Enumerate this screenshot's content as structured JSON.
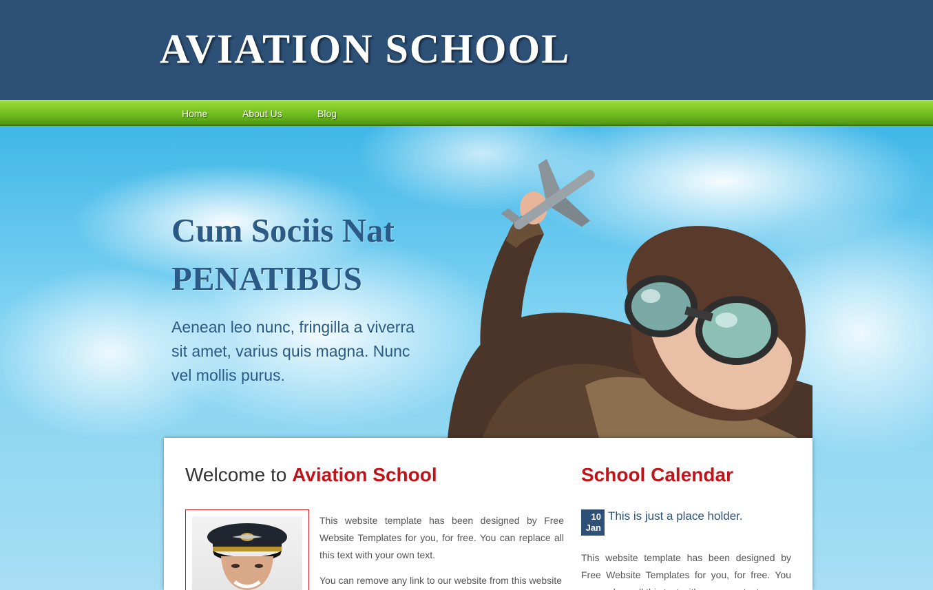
{
  "header": {
    "logo_text": "AVIATION SCHOOL"
  },
  "nav": {
    "items": [
      {
        "label": "Home"
      },
      {
        "label": "About Us"
      },
      {
        "label": "Blog"
      }
    ]
  },
  "hero": {
    "title_line1": "Cum Sociis Nat",
    "title_line2": "PENATIBUS",
    "subtitle": "Aenean leo nunc, fringilla a viverra sit amet, varius quis magna. Nunc vel mollis purus."
  },
  "welcome": {
    "prefix": "Welcome to ",
    "accent": "Aviation School",
    "paragraph1": "This website template has been designed by Free Website Templates for you, for free. You can replace all this text with your own text.",
    "paragraph2": "You can remove any link to our website from this website"
  },
  "calendar": {
    "title": "School Calendar",
    "event": {
      "day": "10",
      "month": "Jan",
      "title": "This is just a place holder.",
      "text": "This website template has been designed by Free Website Templates for you, for free. You can replace all this text with your own text."
    }
  },
  "colors": {
    "header_bg": "#2c5076",
    "nav_green": "#6dba1e",
    "accent_red": "#c0141b",
    "hero_text": "#2a5a85"
  }
}
